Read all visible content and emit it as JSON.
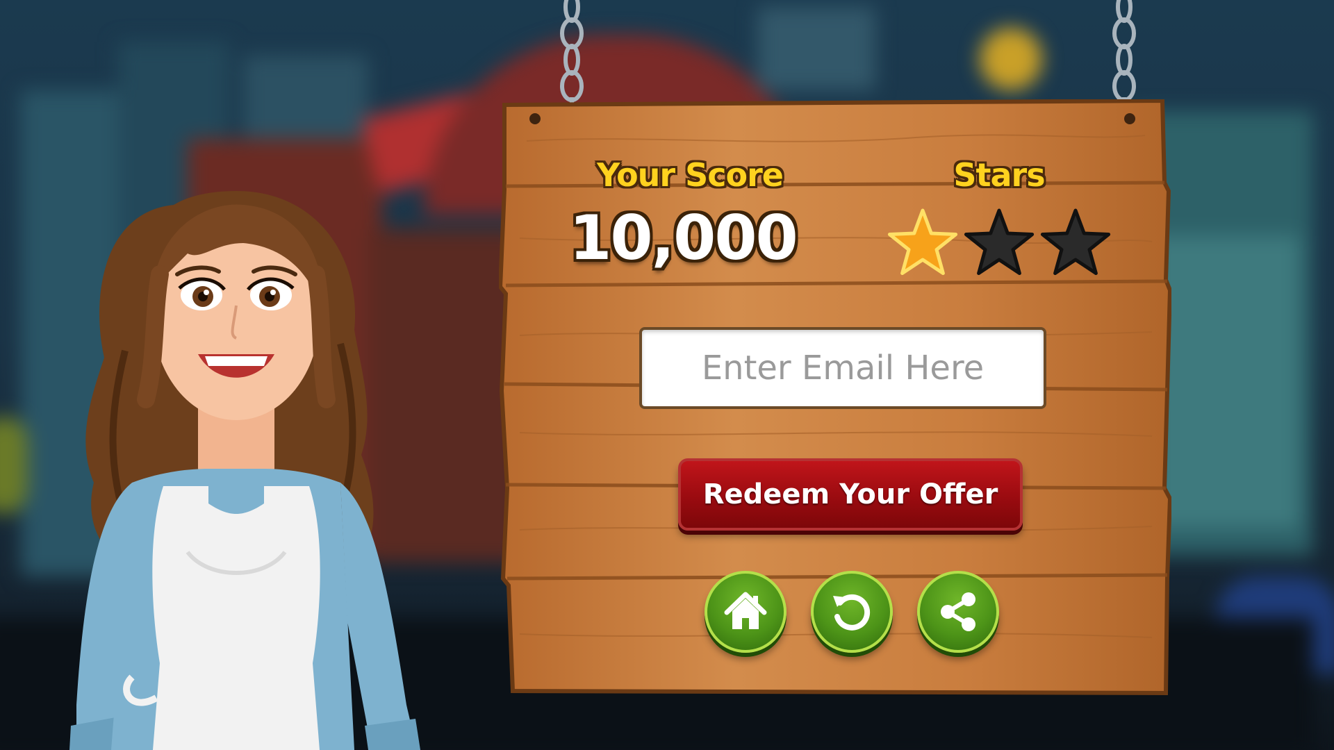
{
  "scoreboard": {
    "score_label": "Your Score",
    "score_value": "10,000",
    "stars_label": "Stars",
    "stars_earned": 1,
    "stars_total": 3
  },
  "email_form": {
    "placeholder": "Enter Email Here",
    "value": ""
  },
  "redeem_button": {
    "label": "Redeem Your Offer"
  },
  "action_buttons": [
    {
      "icon": "home-icon"
    },
    {
      "icon": "replay-icon"
    },
    {
      "icon": "share-icon"
    }
  ],
  "colors": {
    "label_yellow": "#ffd21f",
    "redeem_red": "#9a0b10",
    "button_green": "#4d9418",
    "star_gold": "#f7a21a",
    "star_empty": "#2a2a2a",
    "wood": "#c97d3e"
  }
}
